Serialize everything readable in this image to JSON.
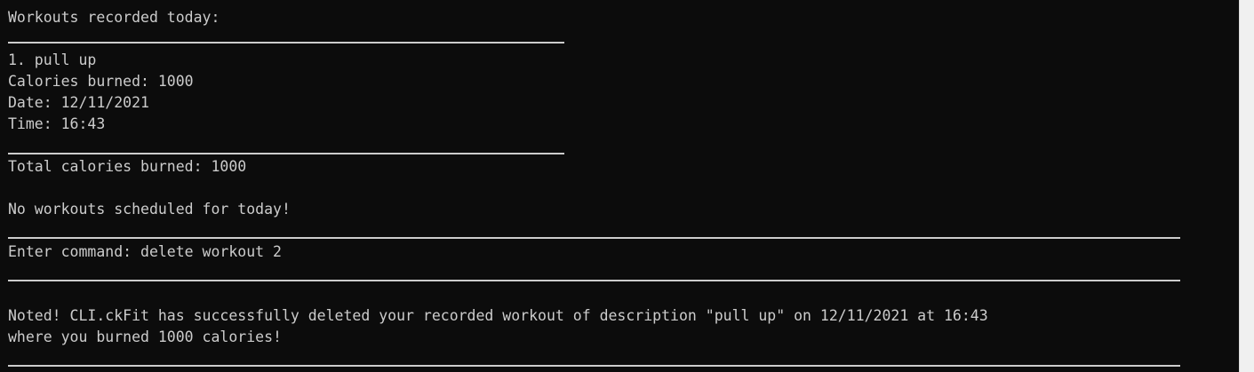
{
  "terminal": {
    "lines": [
      "Workouts recorded today:",
      "1. pull up",
      "Calories burned: 1000",
      "Date: 12/11/2021",
      "Time: 16:43",
      "Total calories burned: 1000",
      "No workouts scheduled for today!",
      "Enter command: delete workout 2",
      "Noted! CLI.ckFit has successfully deleted your recorded workout of description \"pull up\" on 12/11/2021 at 16:43",
      "where you burned 1000 calories!"
    ]
  },
  "colors": {
    "background": "#0c0c0c",
    "foreground": "#cccccc",
    "scrollbar": "#f0f0f0"
  }
}
